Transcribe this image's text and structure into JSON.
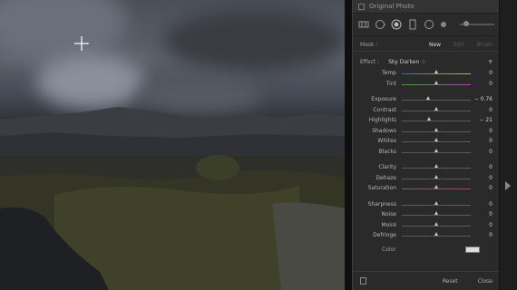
{
  "panel": {
    "title": "Original Photo",
    "mask": {
      "label": "Mask :",
      "options": [
        "New",
        "Edit",
        "Brush"
      ],
      "active": "New"
    },
    "effect": {
      "label": "Effect :",
      "value": "Sky Darken ♢"
    },
    "sliders": [
      {
        "name": "Temp",
        "value": "0",
        "pos": 0.5,
        "track": "temp"
      },
      {
        "name": "Tint",
        "value": "0",
        "pos": 0.5,
        "track": "tint"
      },
      {
        "name": "Exposure",
        "value": "− 0.76",
        "pos": 0.38,
        "track": "gray"
      },
      {
        "name": "Contrast",
        "value": "0",
        "pos": 0.5,
        "track": "gray"
      },
      {
        "name": "Highlights",
        "value": "− 21",
        "pos": 0.39,
        "track": "gray"
      },
      {
        "name": "Shadows",
        "value": "0",
        "pos": 0.5,
        "track": "gray"
      },
      {
        "name": "Whites",
        "value": "0",
        "pos": 0.5,
        "track": "gray"
      },
      {
        "name": "Blacks",
        "value": "0",
        "pos": 0.5,
        "track": "gray"
      },
      {
        "name": "Clarity",
        "value": "0",
        "pos": 0.5,
        "track": "gray"
      },
      {
        "name": "Dehaze",
        "value": "0",
        "pos": 0.5,
        "track": "gray"
      },
      {
        "name": "Saturation",
        "value": "0",
        "pos": 0.5,
        "track": "sat"
      },
      {
        "name": "Sharpness",
        "value": "0",
        "pos": 0.5,
        "track": "gray"
      },
      {
        "name": "Noise",
        "value": "0",
        "pos": 0.5,
        "track": "gray"
      },
      {
        "name": "Moiré",
        "value": "0",
        "pos": 0.5,
        "track": "gray"
      },
      {
        "name": "Defringe",
        "value": "0",
        "pos": 0.5,
        "track": "gray"
      }
    ],
    "color_label": "Color",
    "footer": {
      "reset": "Reset",
      "close": "Close"
    }
  },
  "colors": {
    "temp": "linear-gradient(90deg,#3a63b8,#c9b23a)",
    "tint": "linear-gradient(90deg,#3ca040,#b046b0)",
    "sat": "linear-gradient(90deg,#666,#c0387a)",
    "gray": "#5a5a5a"
  }
}
